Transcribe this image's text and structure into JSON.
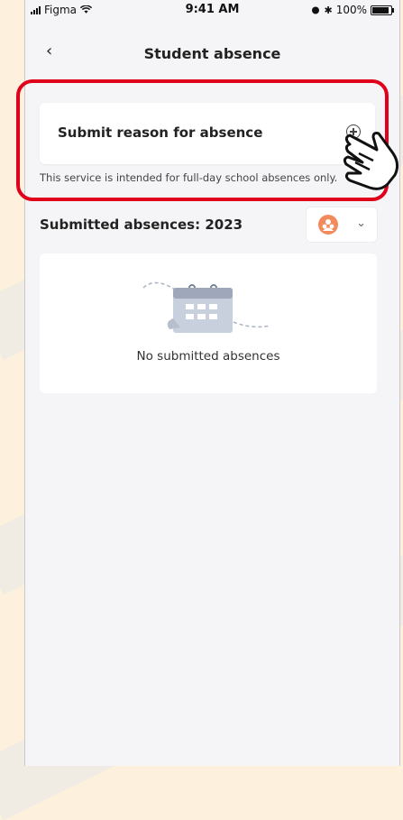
{
  "status_bar": {
    "carrier": "Figma",
    "time": "9:41 AM",
    "battery_text": "100%",
    "battery_level": 1.0
  },
  "nav": {
    "back_icon": "chevron-left-icon",
    "title": "Student absence"
  },
  "submit_card": {
    "label": "Submit reason for absence",
    "icon": "plus-circle-icon"
  },
  "note": "This service is intended for full-day school absences only.",
  "submitted": {
    "title": "Submitted absences: 2023",
    "filter_icon": "users-icon",
    "empty_text": "No submitted absences"
  },
  "colors": {
    "highlight": "#e0001b",
    "avatar": "#f28a5c",
    "background": "#fdf1dd"
  }
}
